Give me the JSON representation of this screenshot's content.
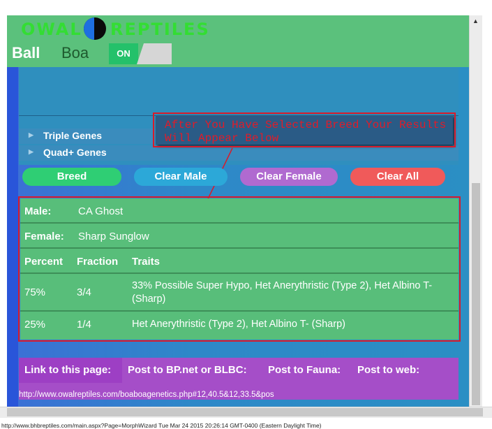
{
  "header": {
    "logo_left": "OWAL",
    "logo_right": "REPTILES",
    "species_primary": "Ball",
    "species_secondary": "Boa",
    "toggle_state": "ON"
  },
  "genes": {
    "triple": "Triple Genes",
    "quad": "Quad+ Genes"
  },
  "note": "After You Have Selected Breed Your Results Will Appear Below",
  "buttons": {
    "breed": "Breed",
    "clear_male": "Clear Male",
    "clear_female": "Clear Female",
    "clear_all": "Clear All"
  },
  "results": {
    "male_label": "Male:",
    "male_value": "CA Ghost",
    "female_label": "Female:",
    "female_value": "Sharp Sunglow",
    "columns": [
      "Percent",
      "Fraction",
      "Traits"
    ],
    "rows": [
      {
        "percent": "75%",
        "fraction": "3/4",
        "traits": "33% Possible Super Hypo, Het Anerythristic (Type 2), Het Albino T- (Sharp)"
      },
      {
        "percent": "25%",
        "fraction": "1/4",
        "traits": "Het Anerythristic (Type 2), Het Albino T- (Sharp)"
      }
    ]
  },
  "share": {
    "link_label": "Link to this page:",
    "bp_label": "Post to BP.net or BLBC:",
    "fauna_label": "Post to Fauna:",
    "web_label": "Post to web:",
    "url": "http://www.owalreptiles.com/boaboagenetics.php#12,40.5&12,33.5&pos"
  },
  "status": "http://www.bhbreptiles.com/main.aspx?Page=MorphWizard Tue Mar 24 2015 20:26:14 GMT-0400 (Eastern Daylight Time)",
  "colors": {
    "header_green": "#5bc17c",
    "breed": "#2fce74",
    "clear_male": "#2ca8d8",
    "clear_female": "#b06ad0",
    "clear_all": "#f05a5a",
    "note_red": "#d81b2a"
  }
}
